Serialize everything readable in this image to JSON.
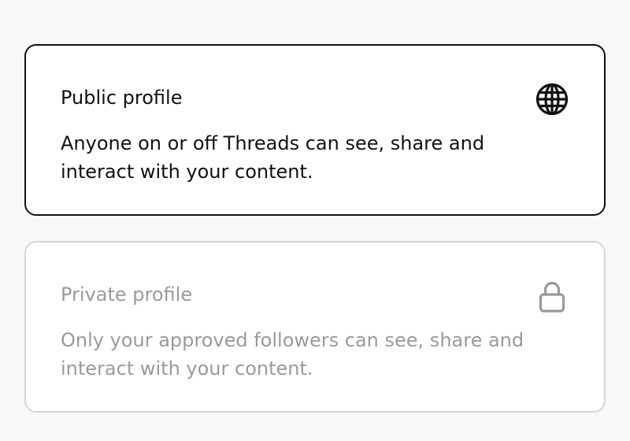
{
  "options": [
    {
      "title": "Public profile",
      "description": "Anyone on or off Threads can see, share and interact with your content.",
      "icon": "globe-icon",
      "selected": true
    },
    {
      "title": "Private profile",
      "description": "Only your approved followers can see, share and interact with your content.",
      "icon": "lock-icon",
      "selected": false
    }
  ],
  "colors": {
    "background": "#f8f8f8",
    "card_background": "#ffffff",
    "selected_border": "#111111",
    "unselected_border": "#d6d6d6",
    "selected_text": "#111111",
    "unselected_text": "#9a9a9a"
  }
}
